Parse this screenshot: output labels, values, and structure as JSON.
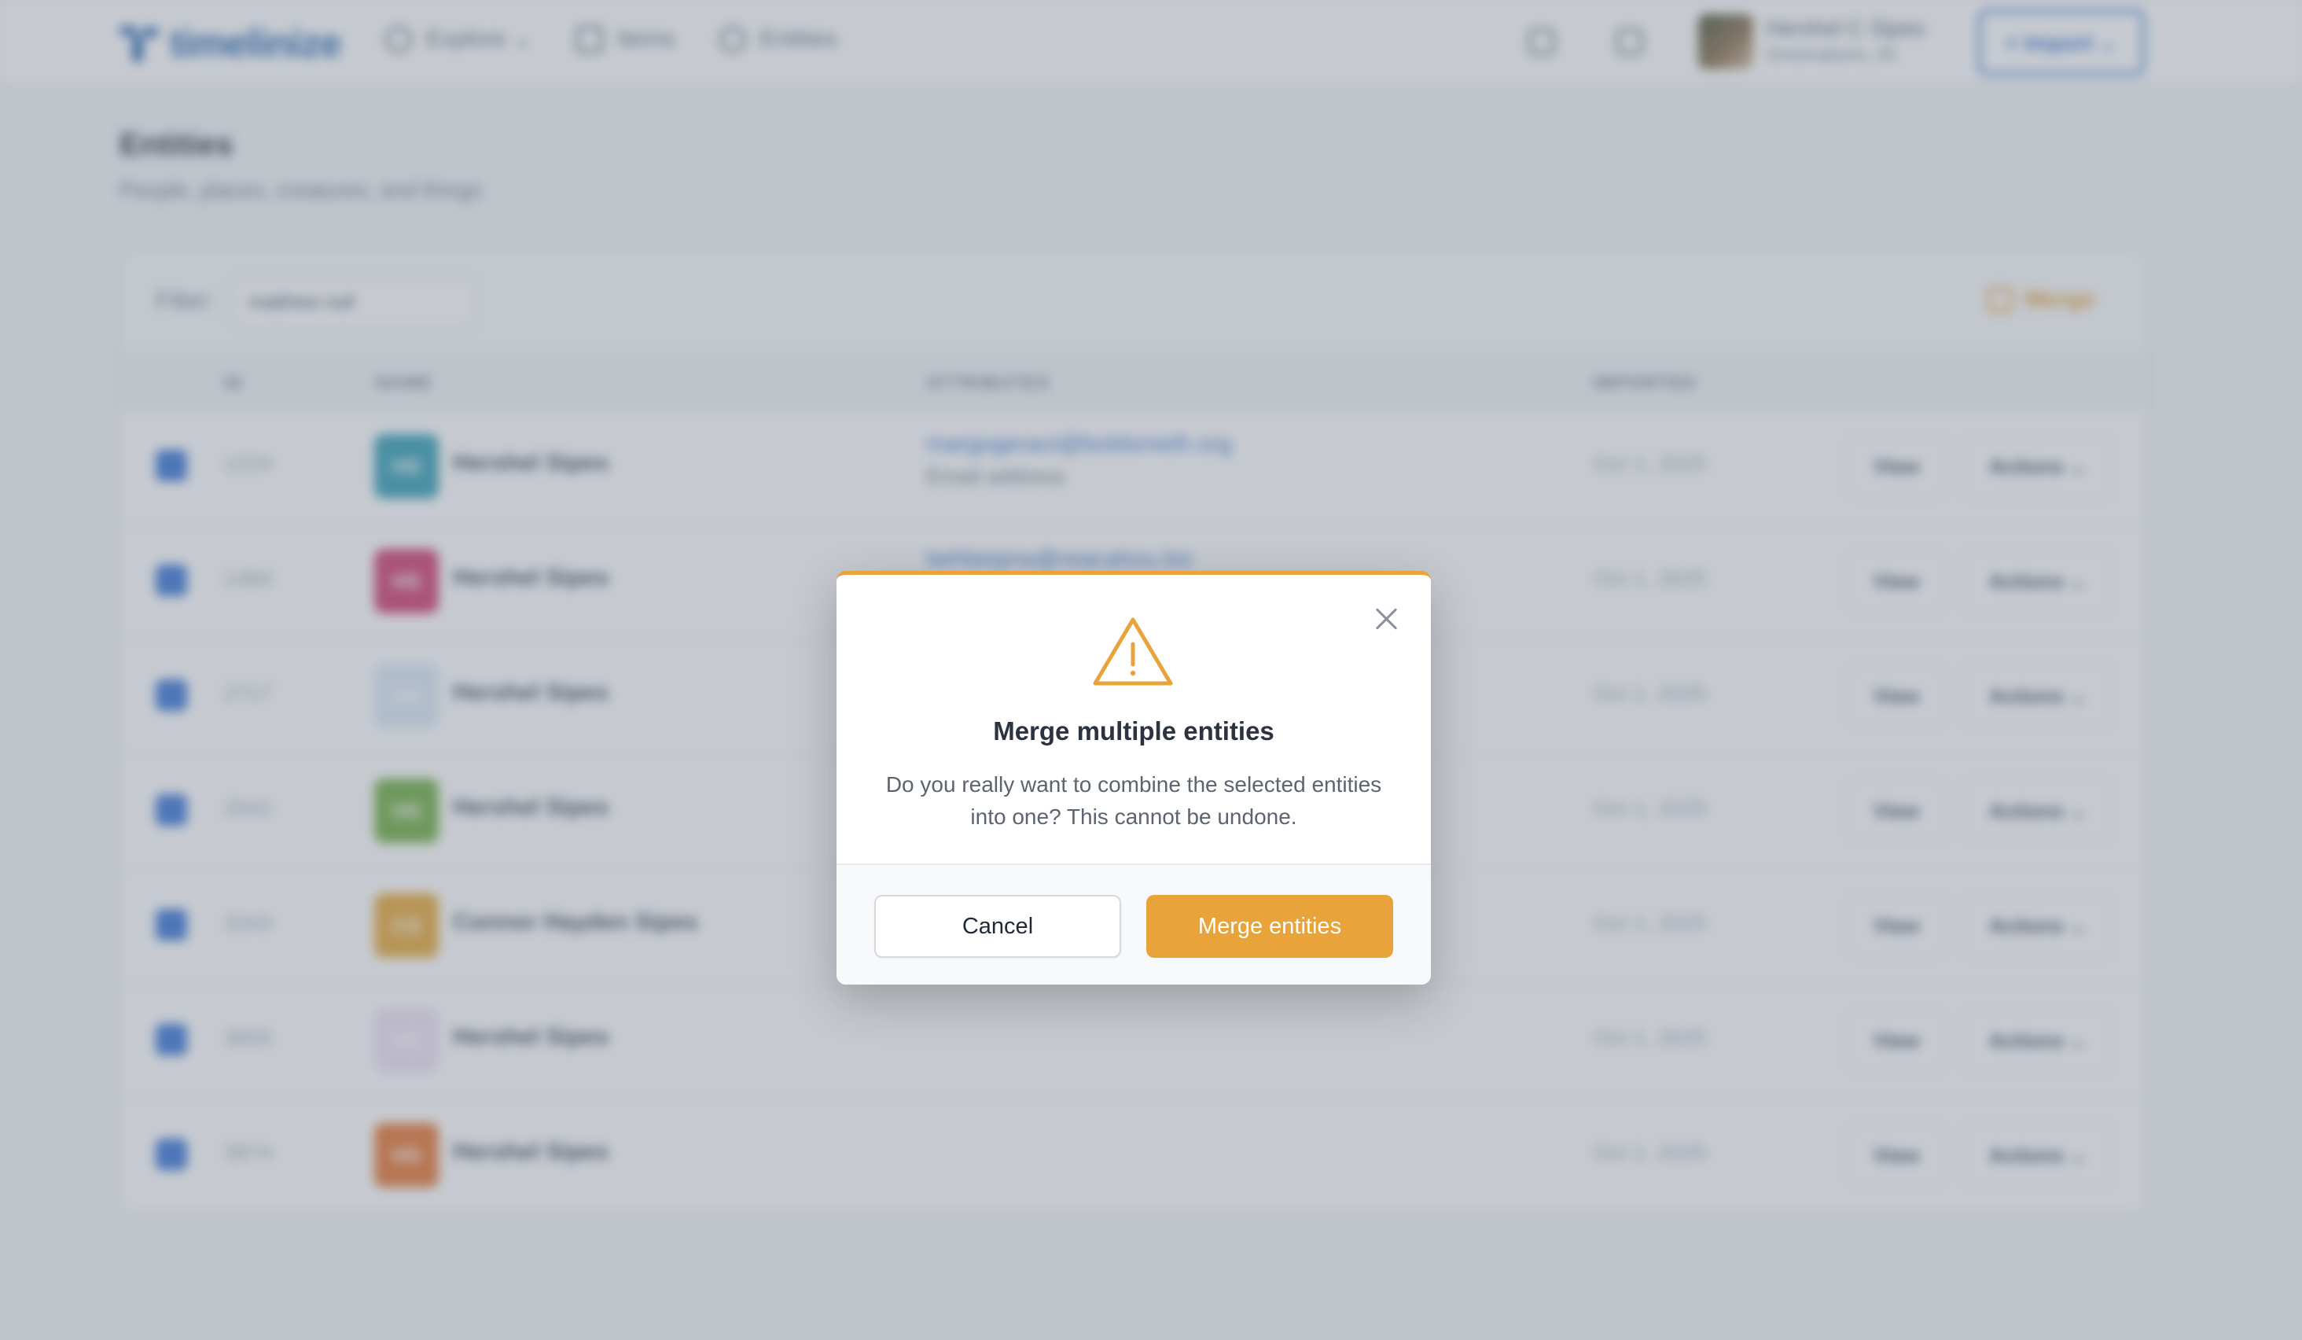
{
  "header": {
    "logo_text": "timelinize",
    "nav": [
      {
        "label": "Explore ⌄",
        "icon": "compass-icon"
      },
      {
        "label": "Items",
        "icon": "document-icon"
      },
      {
        "label": "Entities",
        "icon": "person-icon"
      }
    ],
    "user_name": "Hershel C Sipes",
    "user_sub": "Greenaboro, IN",
    "import_label": "+ Import ⌄"
  },
  "page": {
    "title": "Entities",
    "subtitle": "People, places, creatures, and things"
  },
  "filter": {
    "label": "Filter:",
    "value": "matthew null",
    "merge_label": "Merge"
  },
  "table": {
    "headers": [
      "ID",
      "NAME",
      "ATTRIBUTES",
      "IMPORTED"
    ],
    "view_label": "View",
    "actions_label": "Actions ⌄",
    "rows": [
      {
        "id": "1224",
        "initials": "HS",
        "color": "#2b9bb3",
        "name": "Hershel Sipes",
        "attr1": "margogeract@boldsmeth.org",
        "attr2": "Email address",
        "date": "Oct 1, 2025"
      },
      {
        "id": "1484",
        "initials": "HS",
        "color": "#cf3468",
        "name": "Hershel Sipes",
        "attr1": "behbeiprw@reacahou.biz",
        "attr2": "",
        "date": "Oct 1, 2025"
      },
      {
        "id": "2717",
        "initials": "HS",
        "color": "#dbe7f6",
        "name": "Hershel Sipes",
        "attr1": "",
        "attr2": "",
        "date": "Oct 1, 2025"
      },
      {
        "id": "2942",
        "initials": "HS",
        "color": "#6aaa3a",
        "name": "Hershel Sipes",
        "attr1": "",
        "attr2": "",
        "date": "Oct 1, 2025"
      },
      {
        "id": "3343",
        "initials": "CS",
        "color": "#e6a42f",
        "name": "Connor Hayden Sipes",
        "attr1": "",
        "attr2": "",
        "date": "Oct 1, 2025"
      },
      {
        "id": "3855",
        "initials": "HS",
        "color": "#efe2f4",
        "name": "Hershel Sipes",
        "attr1": "",
        "attr2": "",
        "date": "Oct 1, 2025"
      },
      {
        "id": "3874",
        "initials": "HS",
        "color": "#e5702a",
        "name": "Hershel Sipes",
        "attr1": "",
        "attr2": "",
        "date": "Oct 1, 2025"
      }
    ]
  },
  "modal": {
    "icon": "warning-triangle-icon",
    "title": "Merge multiple entities",
    "body": "Do you really want to combine the selected entities into one? This cannot be undone.",
    "cancel_label": "Cancel",
    "confirm_label": "Merge entities",
    "accent_color": "#e8a33a"
  }
}
